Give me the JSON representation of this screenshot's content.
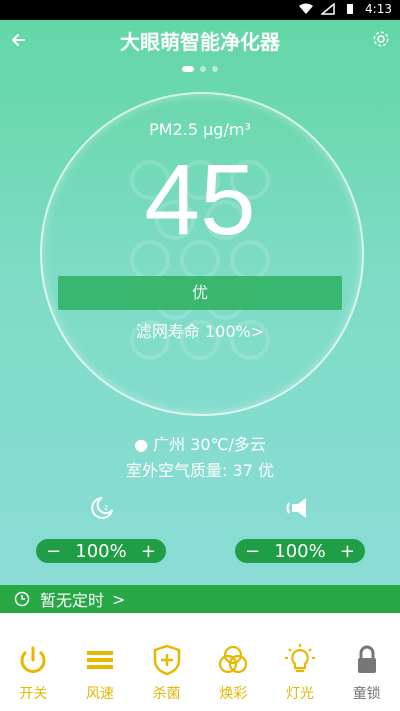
{
  "status_bar": {
    "time": "4:13"
  },
  "header": {
    "title": "大眼萌智能净化器"
  },
  "carousel": {
    "page_count": 3,
    "active_index": 0
  },
  "air": {
    "pm_label": "PM2.5  μg/m³",
    "pm_value": "45",
    "quality": "优",
    "filter_life": "滤网寿命 100%>"
  },
  "location": {
    "weather": "广州 30℃/多云",
    "outdoor_quality": "室外空气质量: 37 优"
  },
  "controls": {
    "left": {
      "minus": "−",
      "value": "100%",
      "plus": "+"
    },
    "right": {
      "minus": "−",
      "value": "100%",
      "plus": "+"
    }
  },
  "timer": {
    "label": "暂无定时",
    "chevron": ">"
  },
  "bottom_nav": [
    {
      "label": "开关",
      "icon": "power-icon"
    },
    {
      "label": "风速",
      "icon": "wind-speed-icon"
    },
    {
      "label": "杀菌",
      "icon": "shield-plus-icon"
    },
    {
      "label": "焕彩",
      "icon": "color-circles-icon"
    },
    {
      "label": "灯光",
      "icon": "bulb-icon"
    },
    {
      "label": "童锁",
      "icon": "lock-icon"
    }
  ],
  "colors": {
    "accent": "#e6b800",
    "green": "#28a745"
  }
}
